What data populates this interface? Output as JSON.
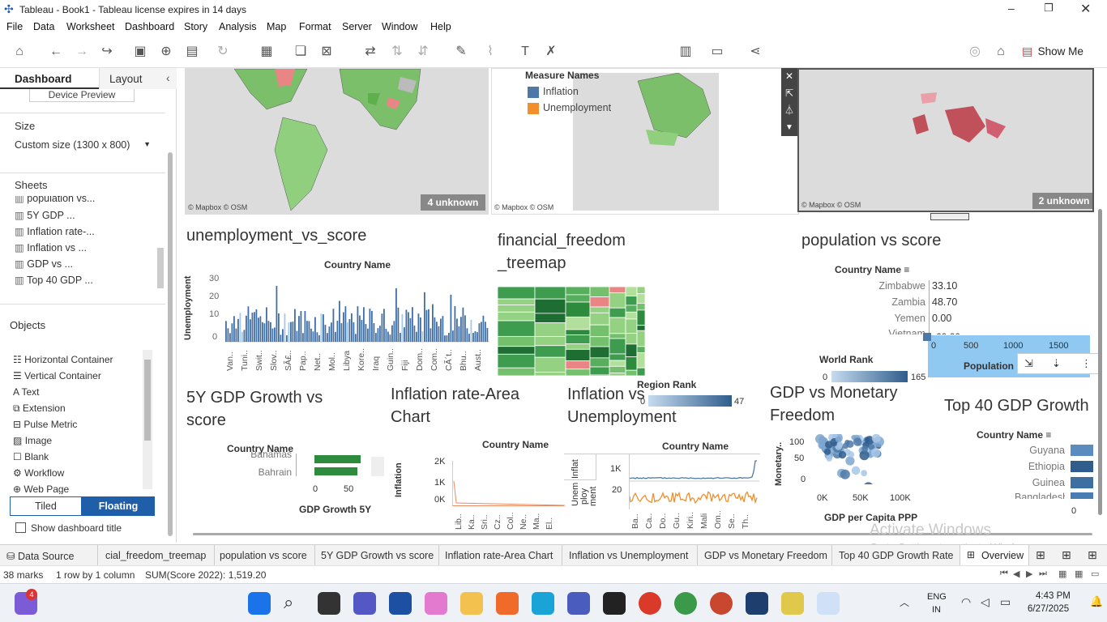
{
  "window": {
    "title": "Tableau - Book1 - Tableau license expires in 14 days"
  },
  "menu": [
    "File",
    "Data",
    "Worksheet",
    "Dashboard",
    "Story",
    "Analysis",
    "Map",
    "Format",
    "Server",
    "Window",
    "Help"
  ],
  "toolbar": {
    "show_me": "Show Me"
  },
  "left": {
    "tab_dashboard": "Dashboard",
    "tab_layout": "Layout",
    "device_preview": "Device Preview",
    "size_label": "Size",
    "size_value": "Custom size (1300 x 800)",
    "sheets_label": "Sheets",
    "sheets": [
      "population vs...",
      "5Y GDP ...",
      "Inflation rate-...",
      "Inflation vs ...",
      "GDP vs ...",
      "Top 40 GDP ..."
    ],
    "objects_label": "Objects",
    "objects": [
      "Horizontal Container",
      "Vertical Container",
      "Text",
      "Extension",
      "Pulse Metric",
      "Image",
      "Blank",
      "Workflow",
      "Web Page"
    ],
    "tiled": "Tiled",
    "floating": "Floating",
    "show_title": "Show dashboard title"
  },
  "maps": {
    "mapbox": "© Mapbox © OSM",
    "unknown1": "4 unknown",
    "unknown2": "2 unknown",
    "legend_title": "Measure Names",
    "legend_items": [
      {
        "name": "Inflation",
        "color": "#4e79a7"
      },
      {
        "name": "Unemployment",
        "color": "#f28e2b"
      }
    ]
  },
  "unemp": {
    "title": "unemployment_vs_score",
    "header": "Country Name",
    "ylabel": "Unemployment",
    "yticks": [
      "30",
      "20",
      "10",
      "0"
    ],
    "xticks": [
      "Van..",
      "Tuni..",
      "Swit..",
      "Slov..",
      "SÃ£..",
      "Pap..",
      "Net..",
      "Mol..",
      "Libya",
      "Kore..",
      "Iraq",
      "Guin..",
      "Fiji",
      "Dom..",
      "Com..",
      "CÃ´t..",
      "Bhu..",
      "Aust.."
    ]
  },
  "treemap": {
    "title1": "financial_freedom",
    "title2": "_treemap",
    "region_rank": "Region Rank",
    "rr_min": "0",
    "rr_max": "47"
  },
  "pop": {
    "title": "population vs score",
    "header": "Country Name",
    "rows": [
      {
        "c": "Zimbabwe",
        "v": "33.10"
      },
      {
        "c": "Zambia",
        "v": "48.70"
      },
      {
        "c": "Yemen",
        "v": "0.00"
      },
      {
        "c": "Vietnam",
        "v": "60.60"
      }
    ],
    "xticks": [
      "0",
      "500",
      "1000",
      "1500"
    ],
    "xlabel": "Population",
    "world_rank": "World Rank",
    "wr_min": "0",
    "wr_max": "165"
  },
  "gdp5": {
    "title1": "5Y GDP Growth vs",
    "title2": "score",
    "header": "Country Name",
    "rows": [
      "Bahamas",
      "Bahrain"
    ],
    "xticks": [
      "0",
      "50"
    ],
    "xlabel": "GDP Growth 5Y"
  },
  "infarea": {
    "title1": "Inflation rate-Area",
    "title2": "Chart",
    "header": "Country Name",
    "ylabel": "Inflation",
    "yticks": [
      "2K",
      "1K",
      "0K"
    ],
    "xticks": [
      "Lib..",
      "Ka..",
      "Sri..",
      "Cz..",
      "Col..",
      "Ne..",
      "Ma..",
      "El.."
    ]
  },
  "infun": {
    "title1": "Inflation vs",
    "title2": "Unemployment",
    "header": "Country Name",
    "row1": "Inflat",
    "row2a": "Unem",
    "row2b": "ploy",
    "row2c": "ment",
    "t1": "1K",
    "t2": "20",
    "xticks": [
      "Ba..",
      "Ca..",
      "Do..",
      "Gu..",
      "Kiri..",
      "Mali",
      "Om..",
      "Se..",
      "Th.."
    ]
  },
  "gdpmf": {
    "title1": "GDP vs Monetary",
    "title2": "Freedom",
    "ylabel": "Monetary..",
    "yticks": [
      "100",
      "50",
      "0"
    ],
    "xticks": [
      "0K",
      "50K",
      "100K"
    ],
    "xlabel": "GDP per Capita PPP"
  },
  "top40": {
    "title": "Top 40 GDP Growth",
    "header": "Country Name",
    "rows": [
      "Guyana",
      "Ethiopia",
      "Guinea",
      "Bangladesh"
    ],
    "xtick": "0"
  },
  "tabs": {
    "data_source": "Data Source",
    "sheets": [
      "cial_freedom_treemap",
      "population vs score",
      "5Y GDP Growth vs score",
      "Inflation rate-Area Chart",
      "Inflation vs Unemployment",
      "GDP vs Monetary Freedom",
      "Top 40 GDP Growth Rate"
    ],
    "active": "Overview"
  },
  "status": {
    "marks": "38 marks",
    "rows": "1 row by 1 column",
    "sum": "SUM(Score 2022): 1,519.20"
  },
  "watermark": {
    "line1": "Activate Windows",
    "line2": "Go to Settings to activate Windows."
  },
  "taskbar": {
    "lang1": "ENG",
    "lang2": "IN",
    "time": "4:43 PM",
    "date": "6/27/2025",
    "badge": "4"
  }
}
